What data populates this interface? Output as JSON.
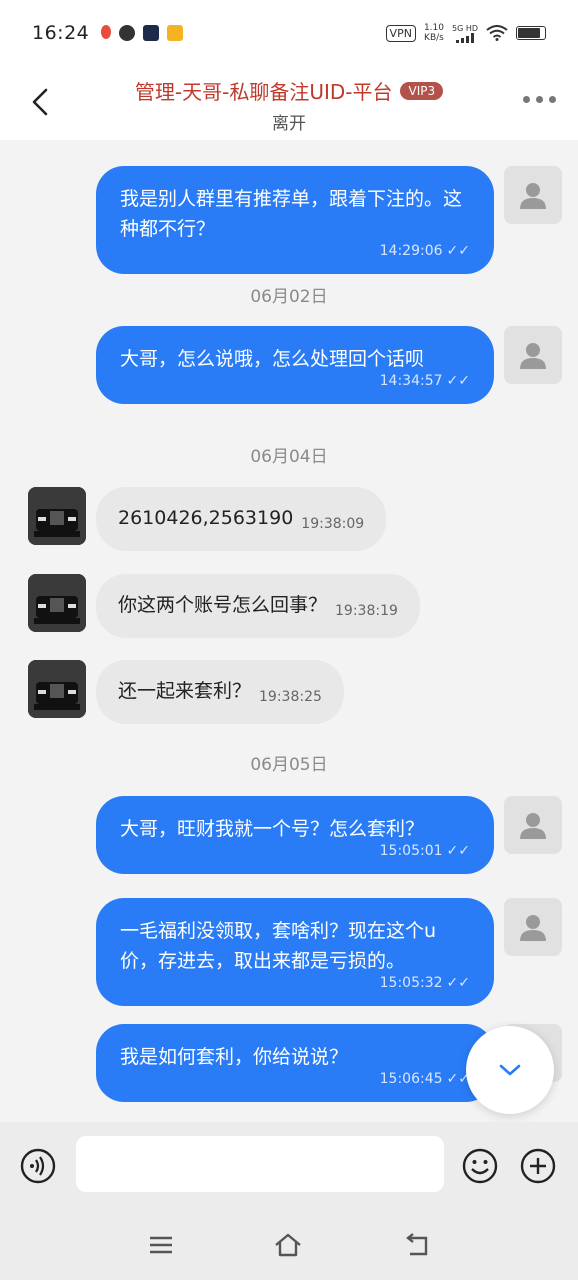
{
  "status_bar": {
    "time": "16:24",
    "vpn": "VPN",
    "speed_value": "1.10",
    "speed_unit": "KB/s",
    "network": "5G HD"
  },
  "header": {
    "title": "管理-天哥-私聊备注UID-平台",
    "badge": "VIP3",
    "subtitle": "离开"
  },
  "messages": [
    {
      "direction": "out",
      "text": "我是别人群里有推荐单，跟着下注的。这种都不行？",
      "time": "14:29:06"
    },
    {
      "type": "date",
      "text": "06月02日"
    },
    {
      "direction": "out",
      "text": "大哥，怎么说哦，怎么处理回个话呗",
      "time": "14:34:57"
    },
    {
      "type": "date",
      "text": "06月04日"
    },
    {
      "direction": "in",
      "text": "2610426,2563190",
      "time": "19:38:09"
    },
    {
      "direction": "in",
      "text": "你这两个账号怎么回事？",
      "time": "19:38:19"
    },
    {
      "direction": "in",
      "text": "还一起来套利？",
      "time": "19:38:25"
    },
    {
      "type": "date",
      "text": "06月05日"
    },
    {
      "direction": "out",
      "text": "大哥，旺财我就一个号？怎么套利？",
      "time": "15:05:01"
    },
    {
      "direction": "out",
      "text": "一毛福利没领取，套啥利？现在这个u价，存进去，取出来都是亏损的。",
      "time": "15:05:32"
    },
    {
      "direction": "out",
      "text": "我是如何套利，你给说说？",
      "time": "15:06:45"
    }
  ],
  "input": {
    "placeholder": ""
  },
  "colors": {
    "outgoing_bubble": "#2a7cf6",
    "incoming_bubble": "#e8e8e8",
    "title": "#c0392b",
    "badge": "#b3524a"
  },
  "icons": [
    "back-arrow-icon",
    "more-icon",
    "default-avatar-icon",
    "car-avatar-icon",
    "chevron-down-icon",
    "voice-icon",
    "emoji-icon",
    "plus-icon",
    "menu-icon",
    "home-icon",
    "back-nav-icon"
  ]
}
